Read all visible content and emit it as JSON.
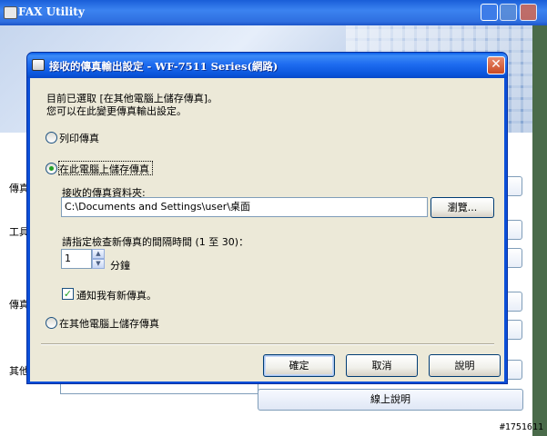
{
  "background_window": {
    "title": "FAX Utility",
    "side_labels": [
      "傳真",
      "工具",
      "傳真",
      "其他"
    ],
    "online_help_label": "線上說明"
  },
  "dialog": {
    "title": "接收的傳真輸出設定 - WF-7511 Series(網路)",
    "close_glyph": "✕",
    "current_selection_line": "目前已選取 [在其他電腦上儲存傳真]。",
    "change_hint_line": "您可以在此變更傳真輸出設定。",
    "options": {
      "print_fax": {
        "label": "列印傳真",
        "selected": false
      },
      "save_on_this_pc": {
        "label": "在此電腦上儲存傳真",
        "selected": true
      },
      "save_on_other_pc": {
        "label": "在其他電腦上儲存傳真",
        "selected": false
      }
    },
    "folder": {
      "label": "接收的傳真資料夾:",
      "value": "C:\\Documents and Settings\\user\\桌面",
      "browse_label": "瀏覽..."
    },
    "interval": {
      "label": "請指定檢查新傳真的間隔時間 (1 至 30)：",
      "value": "1",
      "unit": "分鐘"
    },
    "notify": {
      "label": "通知我有新傳真。",
      "checked": true,
      "check_glyph": "✓"
    },
    "buttons": {
      "ok": "確定",
      "cancel": "取消",
      "help": "說明"
    }
  },
  "watermark": "#1751611",
  "colors": {
    "titlebar_blue": "#1e6cf0",
    "dialog_face": "#ece9d8",
    "close_red": "#c94a23",
    "radio_green": "#21a121"
  },
  "icons": [
    "fax-utility-icon",
    "dialog-app-icon",
    "close-icon",
    "minimize-icon",
    "maximize-icon",
    "spin-up-icon",
    "spin-down-icon",
    "checkmark-icon"
  ]
}
